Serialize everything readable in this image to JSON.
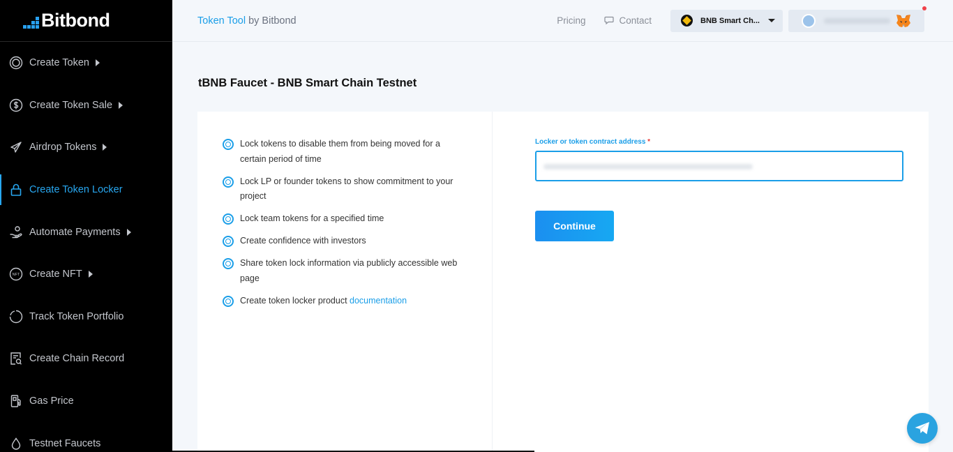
{
  "sidebar": {
    "logo": "Bitbond",
    "items": [
      {
        "label": "Create Token",
        "icon": "coin-icon",
        "caret": true
      },
      {
        "label": "Create Token Sale",
        "icon": "dollar-icon",
        "caret": true
      },
      {
        "label": "Airdrop Tokens",
        "icon": "send-icon",
        "caret": true
      },
      {
        "label": "Create Token Locker",
        "icon": "lock-icon",
        "caret": false,
        "active": true
      },
      {
        "label": "Automate Payments",
        "icon": "hand-coin-icon",
        "caret": true
      },
      {
        "label": "Create NFT",
        "icon": "nft-icon",
        "caret": true
      },
      {
        "label": "Track Token Portfolio",
        "icon": "pie-icon",
        "caret": false
      },
      {
        "label": "Create Chain Record",
        "icon": "record-icon",
        "caret": false
      },
      {
        "label": "Gas Price",
        "icon": "gas-pump-icon",
        "caret": false
      },
      {
        "label": "Testnet Faucets",
        "icon": "drop-icon",
        "caret": false
      }
    ]
  },
  "header": {
    "brand_tool": "Token Tool",
    "brand_by": " by Bitbond",
    "pricing": "Pricing",
    "contact": "Contact",
    "chain": "BNB Smart Ch..."
  },
  "main": {
    "title": "tBNB Faucet - BNB Smart Chain Testnet",
    "features": [
      "Lock tokens to disable them from being moved for a certain period of time",
      "Lock LP or founder tokens to show commitment to your project",
      "Lock team tokens for a specified time",
      "Create confidence with investors",
      "Share token lock information via publicly accessible web page"
    ],
    "doc_prefix": "Create token locker product ",
    "doc_link": "documentation",
    "form": {
      "label": "Locker or token contract address",
      "required_mark": "*",
      "continue": "Continue"
    }
  },
  "colors": {
    "accent": "#1a9ee8",
    "sidebar_bg": "#000000",
    "page_bg": "#f4f7fb"
  }
}
